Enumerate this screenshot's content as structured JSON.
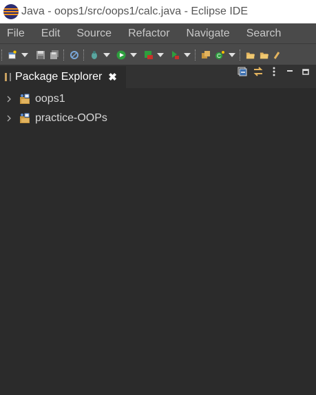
{
  "window": {
    "title": "Java - oops1/src/oops1/calc.java - Eclipse IDE"
  },
  "menu": [
    "File",
    "Edit",
    "Source",
    "Refactor",
    "Navigate",
    "Search"
  ],
  "panel": {
    "tab_label": "Package Explorer",
    "close_glyph": "✖"
  },
  "tree": [
    {
      "label": "oops1",
      "icon": "java-project-icon"
    },
    {
      "label": "practice-OOPs",
      "icon": "java-project-icon"
    }
  ],
  "colors": {
    "accent_orange": "#f7941e",
    "eclipse_blue": "#2c2d72",
    "bg": "#2b2b2b",
    "menubar": "#4a4a4a"
  }
}
